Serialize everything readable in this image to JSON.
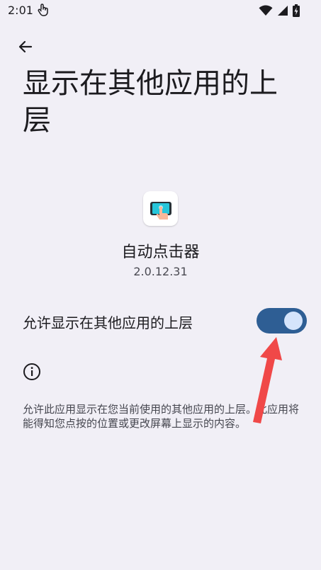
{
  "status_bar": {
    "time": "2:01",
    "icons": [
      "touch-icon",
      "wifi-icon",
      "signal-icon",
      "battery-icon"
    ]
  },
  "header": {
    "back_icon": "arrow-left-icon",
    "title": "显示在其他应用的上层"
  },
  "app": {
    "icon": "auto-clicker-app-icon",
    "name": "自动点击器",
    "version": "2.0.12.31"
  },
  "toggle": {
    "label": "允许显示在其他应用的上层",
    "enabled": true,
    "track_color": "#2e5e94",
    "knob_color": "#d5e4fb"
  },
  "info": {
    "icon": "info-icon",
    "text": "允许此应用显示在您当前使用的其他应用的上层。此应用将能得知您点按的位置或更改屏幕上显示的内容。"
  },
  "colors": {
    "background": "#f1eff6",
    "annotation_arrow": "#f04848"
  }
}
